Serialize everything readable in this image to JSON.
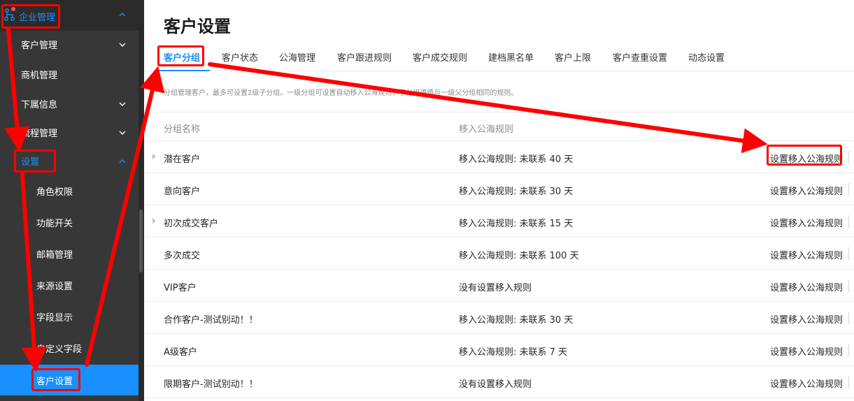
{
  "sidebar": {
    "header": {
      "label": "企业管理",
      "icon": "org-structure-icon",
      "accent": "#1890ff"
    },
    "items": [
      {
        "label": "客户管理",
        "chevron": "down"
      },
      {
        "label": "商机管理",
        "chevron": ""
      },
      {
        "label": "下属信息",
        "chevron": "down"
      },
      {
        "label": "流程管理",
        "chevron": "down"
      },
      {
        "label": "设置",
        "chevron": "up"
      },
      {
        "label": "角色权限",
        "chevron": ""
      },
      {
        "label": "功能开关",
        "chevron": ""
      },
      {
        "label": "邮箱管理",
        "chevron": ""
      },
      {
        "label": "来源设置",
        "chevron": ""
      },
      {
        "label": "字段显示",
        "chevron": ""
      },
      {
        "label": "自定义字段",
        "chevron": ""
      },
      {
        "label": "客户设置",
        "chevron": ""
      }
    ],
    "active_item": "客户设置",
    "active_color": "#1890ff"
  },
  "page": {
    "title": "客户设置"
  },
  "tabs": [
    "客户分组",
    "客户状态",
    "公海管理",
    "客户跟进规则",
    "客户成交规则",
    "建档黑名单",
    "客户上限",
    "客户查重设置",
    "动态设置"
  ],
  "active_tab": "客户分组",
  "hint": "分组管理客户，最多可设置2级子分组。一级分组可设置自动移入公海规则，子分组遵循与一级父分组相同的规则。",
  "table": {
    "headers": {
      "name": "分组名称",
      "rule": "移入公海规则"
    },
    "rows": [
      {
        "name": "潜在客户",
        "rule": "移入公海规则: 未联系 40 天",
        "expandable": true
      },
      {
        "name": "意向客户",
        "rule": "移入公海规则: 未联系 30 天",
        "expandable": false
      },
      {
        "name": "初次成交客户",
        "rule": "移入公海规则: 未联系 15 天",
        "expandable": true
      },
      {
        "name": "多次成交",
        "rule": "移入公海规则: 未联系 100 天",
        "expandable": false
      },
      {
        "name": "VIP客户",
        "rule": "没有设置移入规则",
        "expandable": false
      },
      {
        "name": "合作客户-测试别动！！",
        "rule": "移入公海规则: 未联系 30 天",
        "expandable": false
      },
      {
        "name": "A级客户",
        "rule": "移入公海规则: 未联系 7 天",
        "expandable": false
      },
      {
        "name": "限期客户-测试别动！！",
        "rule": "没有设置移入规则",
        "expandable": false
      }
    ],
    "action_label": "设置移入公海规则"
  },
  "annotation_color": "#ff0000"
}
